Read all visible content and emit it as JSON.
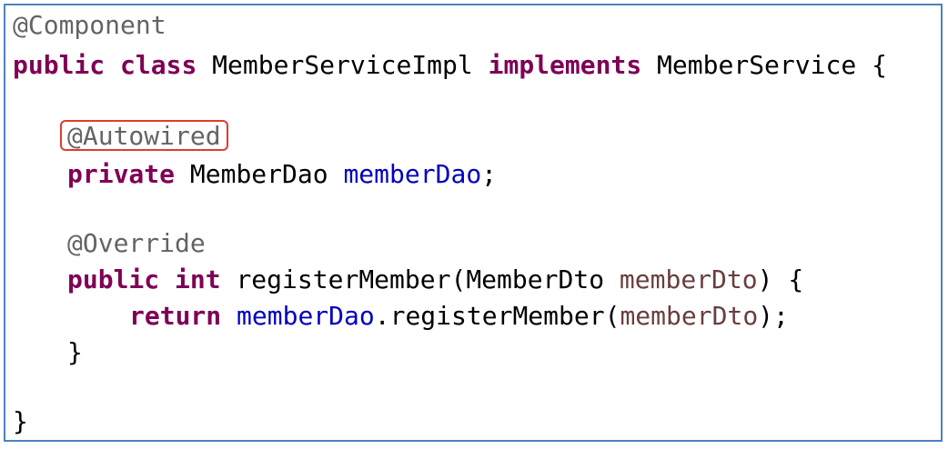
{
  "colors": {
    "panel_border": "#4f81bd",
    "keyword": "#7f0055",
    "annotation": "#646464",
    "field": "#0000c0",
    "param": "#6a3e3e",
    "highlight": "#e03c31"
  },
  "code": {
    "line1": {
      "annotation": "@Component"
    },
    "line2": {
      "kw_public": "public",
      "kw_class": "class",
      "class_name": "MemberServiceImpl",
      "kw_implements": "implements",
      "interface_name": "MemberService",
      "brace_open": "{"
    },
    "line4": {
      "annotation": "@Autowired"
    },
    "line5": {
      "kw_private": "private",
      "type": "MemberDao",
      "field": "memberDao",
      "semicolon": ";"
    },
    "line7": {
      "annotation": "@Override"
    },
    "line8": {
      "kw_public": "public",
      "kw_int": "int",
      "method": "registerMember(",
      "param_type": "MemberDto",
      "param_name": "memberDto",
      "close": ") {"
    },
    "line9": {
      "kw_return": "return",
      "field": "memberDao",
      "call": ".registerMember(",
      "param_name": "memberDto",
      "close": ");"
    },
    "line10": {
      "brace_close": "}"
    },
    "line12": {
      "brace_close": "}"
    }
  }
}
